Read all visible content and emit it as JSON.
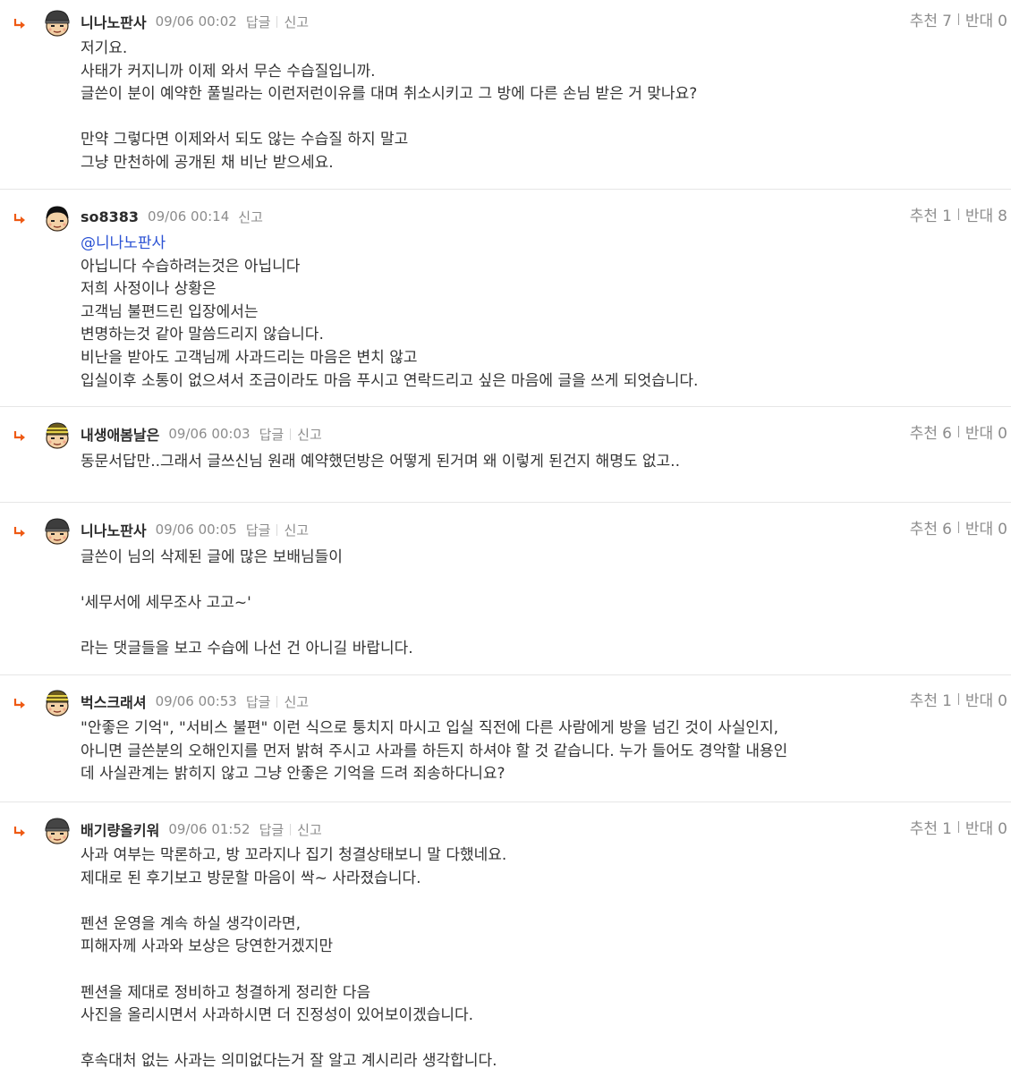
{
  "labels": {
    "reply": "답글",
    "report": "신고",
    "recommend": "추천",
    "oppose": "반대"
  },
  "comments": [
    {
      "nickname": "니나노판사",
      "date": "09/06 00:02",
      "has_reply": true,
      "up": "7",
      "down": "0",
      "mention": "",
      "text": "저기요.\n사태가 커지니까 이제 와서 무슨 수습질입니까.\n글쓴이 분이 예약한 풀빌라는 이런저런이유를 대며 취소시키고 그 방에 다른 손님 받은 거 맞나요?\n\n만약 그렇다면 이제와서 되도 않는 수습질 하지 말고\n그냥 만천하에 공개된 채 비난 받으세요."
    },
    {
      "nickname": "so8383",
      "date": "09/06 00:14",
      "has_reply": false,
      "up": "1",
      "down": "8",
      "mention": "@니나노판사",
      "text": "아닙니다 수습하려는것은 아닙니다\n저희 사정이나 상황은\n고객님 불편드린 입장에서는\n변명하는것 같아 말씀드리지 않습니다.\n비난을 받아도 고객님께 사과드리는 마음은 변치 않고\n입실이후 소통이 없으셔서 조금이라도 마음 푸시고 연락드리고 싶은 마음에 글을 쓰게 되엇습니다."
    },
    {
      "nickname": "내생애봄날은",
      "date": "09/06 00:03",
      "has_reply": true,
      "up": "6",
      "down": "0",
      "mention": "",
      "text": "동문서답만..그래서 글쓰신님 원래 예약했던방은 어떻게 된거며 왜 이렇게 된건지 해명도 없고.."
    },
    {
      "nickname": "니나노판사",
      "date": "09/06 00:05",
      "has_reply": true,
      "up": "6",
      "down": "0",
      "mention": "",
      "text": "글쓴이 님의 삭제된 글에 많은 보배님들이\n\n'세무서에 세무조사 고고~'\n\n라는 댓글들을 보고 수습에 나선 건 아니길 바랍니다."
    },
    {
      "nickname": "벅스크래셔",
      "date": "09/06 00:53",
      "has_reply": true,
      "up": "1",
      "down": "0",
      "mention": "",
      "text": "\"안좋은 기억\", \"서비스 불편\" 이런 식으로 퉁치지 마시고 입실 직전에 다른 사람에게 방을 넘긴 것이 사실인지,\n아니면 글쓴분의 오해인지를 먼저 밝혀 주시고 사과를 하든지 하셔야 할 것 같습니다. 누가 들어도 경악할 내용인\n데 사실관계는 밝히지 않고 그냥 안좋은 기억을 드려 죄송하다니요?"
    },
    {
      "nickname": "배기량올키워",
      "date": "09/06 01:52",
      "has_reply": true,
      "up": "1",
      "down": "0",
      "mention": "",
      "text": "사과 여부는 막론하고, 방 꼬라지나 집기 청결상태보니 말 다했네요.\n제대로 된 후기보고 방문할 마음이 싹~ 사라졌습니다.\n\n펜션 운영을 계속 하실 생각이라면,\n피해자께 사과와 보상은 당연한거겠지만\n\n펜션을 제대로 정비하고 청결하게 정리한 다음\n사진을 올리시면서 사과하시면 더 진정성이 있어보이겠습니다.\n\n후속대처 없는 사과는 의미없다는거 잘 알고 계시리라 생각합니다."
    }
  ]
}
